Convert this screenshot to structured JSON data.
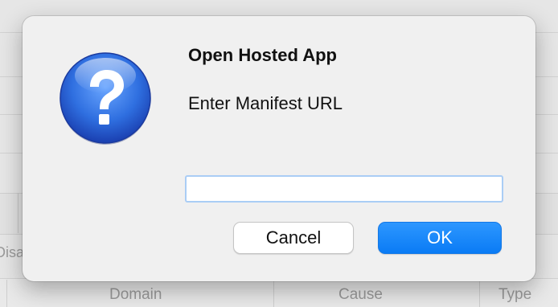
{
  "background": {
    "partial_label": "Disa",
    "columns": [
      "Domain",
      "Cause",
      "Type"
    ]
  },
  "dialog": {
    "icon": "question-mark-icon",
    "title": "Open Hosted App",
    "message": "Enter Manifest URL",
    "input": {
      "value": "",
      "placeholder": ""
    },
    "cancel_label": "Cancel",
    "ok_label": "OK"
  },
  "colors": {
    "accent": "#0a7bf5",
    "icon_blue": "#2f6fe0",
    "dialog_bg": "#f0f0f0",
    "focus_ring": "#aacdf5"
  }
}
